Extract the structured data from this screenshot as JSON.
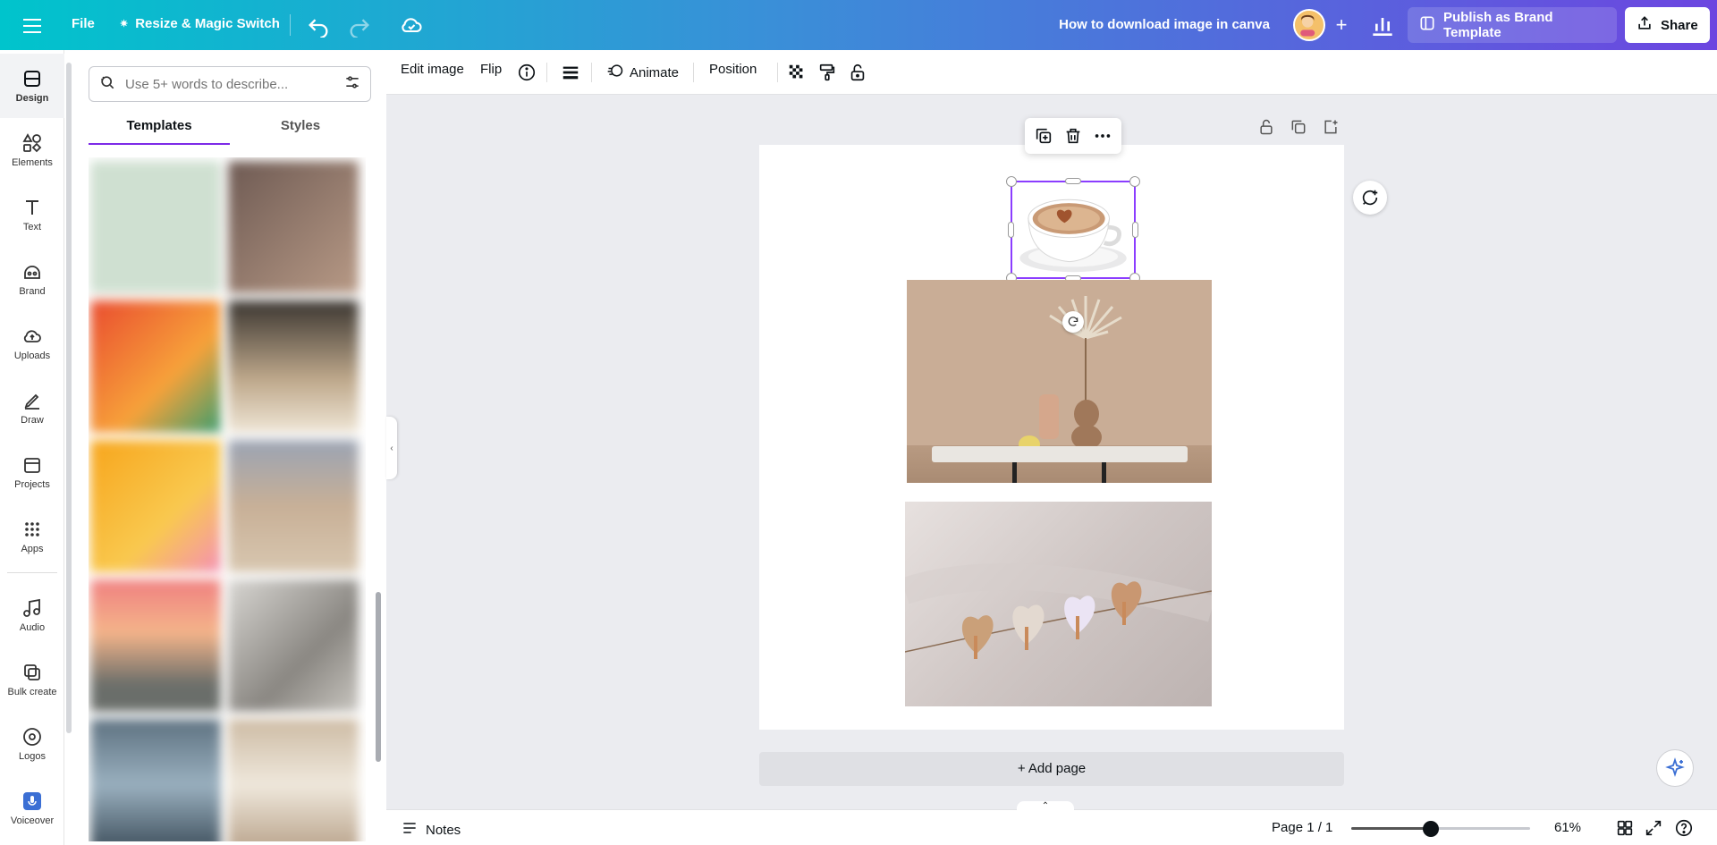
{
  "topbar": {
    "file_label": "File",
    "resize_label": "Resize & Magic Switch",
    "document_title": "How to download image in canva",
    "publish_label": "Publish as Brand Template",
    "share_label": "Share"
  },
  "rail": {
    "items": [
      {
        "label": "Design",
        "icon": "design-icon"
      },
      {
        "label": "Elements",
        "icon": "elements-icon"
      },
      {
        "label": "Text",
        "icon": "text-icon"
      },
      {
        "label": "Brand",
        "icon": "brand-icon"
      },
      {
        "label": "Uploads",
        "icon": "uploads-icon"
      },
      {
        "label": "Draw",
        "icon": "draw-icon"
      },
      {
        "label": "Projects",
        "icon": "projects-icon"
      },
      {
        "label": "Apps",
        "icon": "apps-icon"
      },
      {
        "label": "Audio",
        "icon": "audio-icon"
      },
      {
        "label": "Bulk create",
        "icon": "bulk-create-icon"
      },
      {
        "label": "Logos",
        "icon": "logos-icon"
      },
      {
        "label": "Voiceover",
        "icon": "voiceover-icon"
      }
    ]
  },
  "panel": {
    "search_placeholder": "Use 5+ words to describe...",
    "tabs": [
      {
        "label": "Templates",
        "active": true
      },
      {
        "label": "Styles",
        "active": false
      }
    ]
  },
  "context_toolbar": {
    "edit_image": "Edit image",
    "flip": "Flip",
    "animate": "Animate",
    "position": "Position"
  },
  "canvas": {
    "add_page": "+ Add page"
  },
  "footer": {
    "notes": "Notes",
    "page_indicator": "Page 1 / 1",
    "zoom": "61%",
    "zoom_fraction": 0.61
  },
  "colors": {
    "accent": "#8b3dff",
    "topbar_start": "#00c4cc",
    "topbar_end": "#6c46e0"
  }
}
